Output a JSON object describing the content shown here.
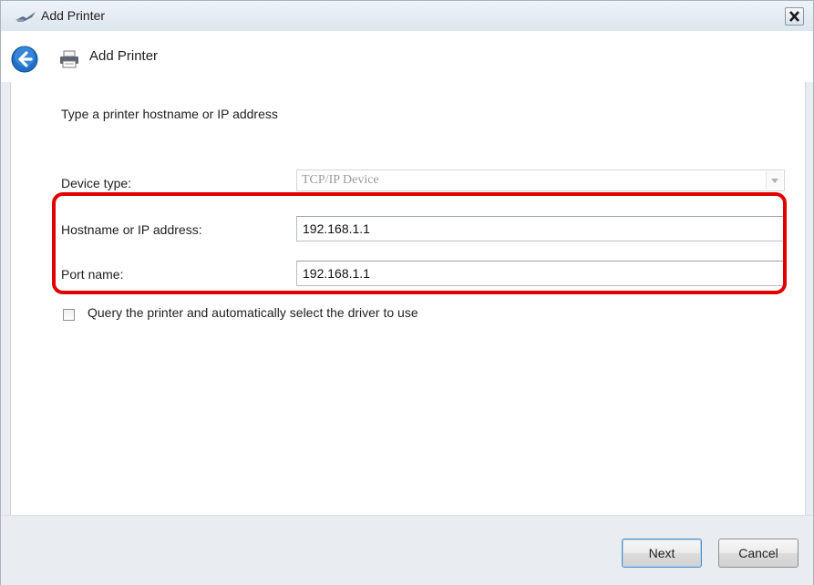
{
  "window": {
    "title": "Add Printer",
    "close_label": "Close"
  },
  "nav": {
    "title": "Add Printer",
    "back_label": "Back"
  },
  "form": {
    "instruction": "Type a printer hostname or IP address",
    "device_type": {
      "label": "Device type:",
      "value": "TCP/IP Device"
    },
    "hostname": {
      "label": "Hostname or IP address:",
      "value": "192.168.1.1"
    },
    "port": {
      "label": "Port name:",
      "value": "192.168.1.1"
    },
    "query_checkbox": {
      "label": "Query the printer and automatically select the driver to use",
      "checked": false
    }
  },
  "footer": {
    "next_label": "Next",
    "cancel_label": "Cancel"
  },
  "colors": {
    "highlight": "#e00000",
    "back_button": "#1f6fc5"
  }
}
